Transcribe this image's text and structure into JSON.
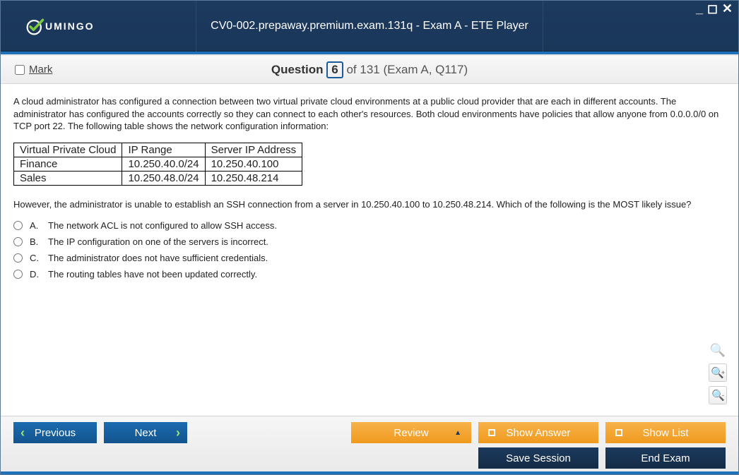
{
  "window": {
    "brand": "UMINGO",
    "title": "CV0-002.prepaway.premium.exam.131q - Exam A - ETE Player"
  },
  "header": {
    "mark_label": "Mark",
    "question_label": "Question",
    "question_number": "6",
    "question_total": "of 131 (Exam A, Q117)"
  },
  "content": {
    "para1": "A cloud administrator has configured a connection between two virtual private cloud environments at a public cloud provider that are each in different accounts. The administrator has configured the accounts correctly so they can connect to each other's resources. Both cloud environments have policies that allow anyone from 0.0.0.0/0 on TCP port 22. The following table shows the network configuration information:",
    "table": {
      "headers": [
        "Virtual Private Cloud",
        "IP Range",
        "Server IP Address"
      ],
      "rows": [
        [
          "Finance",
          "10.250.40.0/24",
          "10.250.40.100"
        ],
        [
          "Sales",
          "10.250.48.0/24",
          "10.250.48.214"
        ]
      ]
    },
    "para2": "However, the administrator is unable to establish an SSH connection from a server in 10.250.40.100 to 10.250.48.214. Which of the following is the MOST likely issue?",
    "options": [
      {
        "letter": "A.",
        "text": "The network ACL is not configured to allow SSH access."
      },
      {
        "letter": "B.",
        "text": "The IP configuration on one of the servers is incorrect."
      },
      {
        "letter": "C.",
        "text": "The administrator does not have sufficient credentials."
      },
      {
        "letter": "D.",
        "text": "The routing tables have not been updated correctly."
      }
    ]
  },
  "footer": {
    "previous": "Previous",
    "next": "Next",
    "review": "Review",
    "show_answer": "Show Answer",
    "show_list": "Show List",
    "save_session": "Save Session",
    "end_exam": "End Exam"
  }
}
